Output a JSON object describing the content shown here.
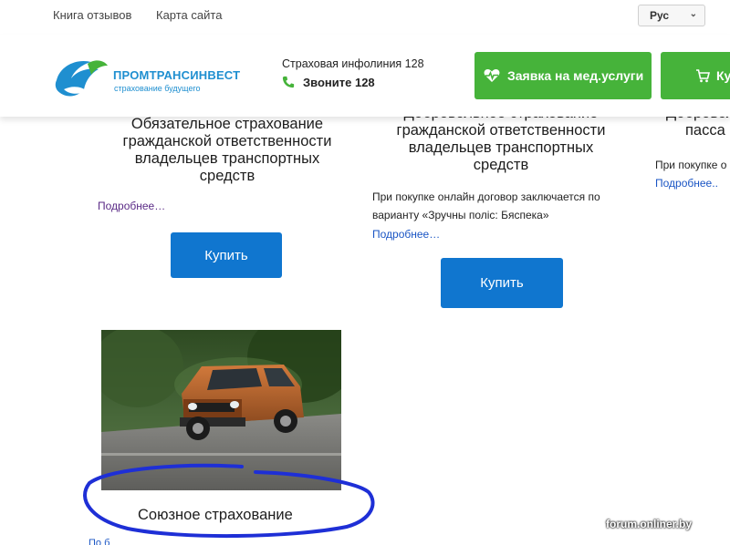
{
  "topbar": {
    "reviews_label": "Книга отзывов",
    "sitemap_label": "Карта сайта",
    "language": "Рус"
  },
  "header": {
    "brand_name": "ПРОМТРАНСИНВЕСТ",
    "tagline": "страхование будущего",
    "infoline_label": "Страховая инфолиния 128",
    "call_label": "Звоните 128",
    "med_button_label": "Заявка на мед.услуги",
    "cart_button_label": "Ку",
    "accent_green": "#46b33a",
    "brand_blue": "#1f8fd0"
  },
  "cards": [
    {
      "title_lines": [
        "Обязательное страхование",
        "гражданской ответственности",
        "владельцев транспортных",
        "средств"
      ],
      "more_label": "Подробнее…",
      "buy_label": "Купить"
    },
    {
      "title_lines": [
        "Добровольное страхование",
        "гражданской ответственности",
        "владельцев транспортных",
        "средств"
      ],
      "description": "При покупке онлайн договор заключается по варианту «Зручны поліс: Бяспека»",
      "more_label": "Подробнее…",
      "buy_label": "Купить"
    },
    {
      "title_lines": [
        "Добровол",
        "пасса"
      ],
      "description": "При покупке о",
      "more_label": "Подробнее.."
    }
  ],
  "featured": {
    "caption": "Союзное страхование",
    "stub": "По б"
  },
  "watermark": "forum.onliner.by",
  "colors": {
    "buy_button_blue": "#1076cf",
    "highlight_circle": "#1e2fd6"
  }
}
